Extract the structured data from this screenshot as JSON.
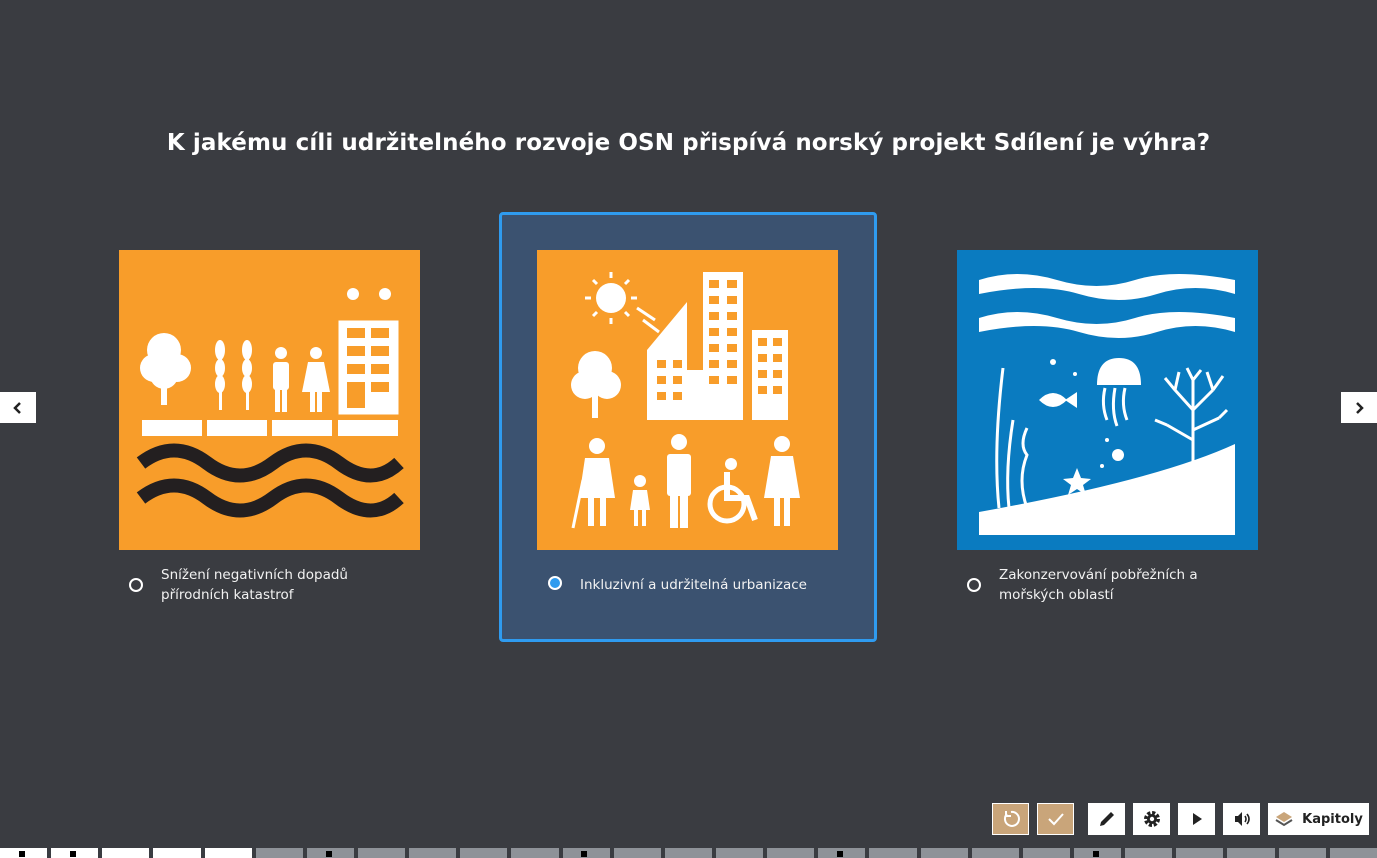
{
  "question": "K jakému cíli udržitelného rozvoje OSN přispívá norský projekt Sdílení je výhra?",
  "options": [
    {
      "label": "Snížení negativních dopadů přírodních katastrof",
      "selected": false,
      "image_color": "#f89d2a"
    },
    {
      "label": "Inkluzivní a udržitelná urbanizace",
      "selected": true,
      "image_color": "#f89d2a"
    },
    {
      "label": "Zakonzervování pobřežních a mořských oblastí",
      "selected": false,
      "image_color": "#0a7bc0"
    }
  ],
  "nav": {
    "prev_icon": "chevron-left-icon",
    "next_icon": "chevron-right-icon"
  },
  "toolbar": {
    "reset_icon": "reset-icon",
    "submit_icon": "check-icon",
    "draw_icon": "pencil-icon",
    "settings_icon": "gear-icon",
    "play_icon": "play-icon",
    "volume_icon": "volume-icon",
    "chapters_label": "Kapitoly"
  },
  "colors": {
    "background": "#3a3c41",
    "accent": "#2f9bef",
    "selected_bg": "#3b5270",
    "tan": "#c9a57a"
  }
}
